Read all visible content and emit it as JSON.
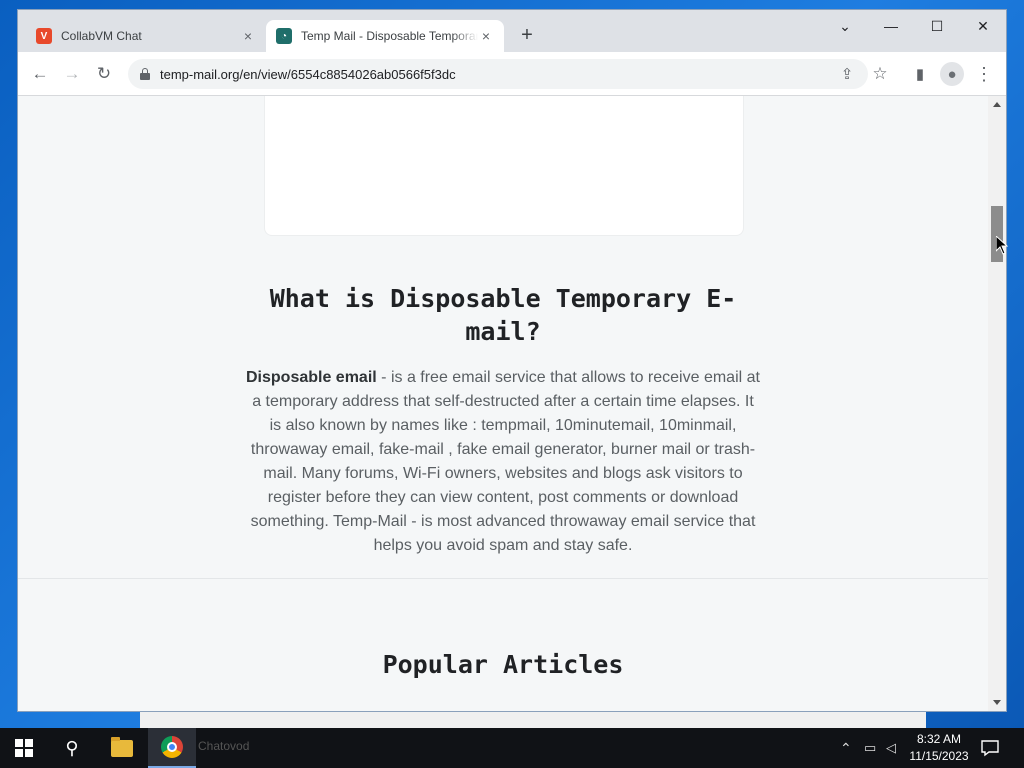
{
  "browser": {
    "tabs": [
      {
        "title": "CollabVM Chat",
        "active": false
      },
      {
        "title": "Temp Mail - Disposable Temporary E-mail",
        "active": true
      }
    ],
    "url": "temp-mail.org/en/view/6554c8854026ab0566f5f3dc"
  },
  "page": {
    "heading_what": "What is Disposable Temporary E-mail?",
    "desc_bold": "Disposable email",
    "desc_text": " - is a free email service that allows to receive email at a temporary address that self-destructed after a certain time elapses. It is also known by names like : tempmail, 10minutemail, 10minmail, throwaway email, fake-mail , fake email generator, burner mail or trash-mail. Many forums, Wi-Fi owners, websites and blogs ask visitors to register before they can view content, post comments or download something. Temp-Mail - is most advanced throwaway email service that helps you avoid spam and stay safe.",
    "heading_popular": "Popular Articles"
  },
  "taskbar": {
    "ghost_label": "Chatovod",
    "time": "8:32 AM",
    "date": "11/15/2023"
  },
  "icons": {
    "tab_close": "×",
    "new_tab": "+",
    "minimize": "—",
    "maximize": "☐",
    "close": "✕",
    "tab_search": "⌄",
    "back": "←",
    "forward": "→",
    "reload": "↻",
    "share": "⇪",
    "star": "☆",
    "sidepanel": "▮",
    "profile": "●",
    "menu": "⋮",
    "search": "⚲",
    "chat": "🗨"
  },
  "colors": {
    "tabstrip": "#dee1e6",
    "page_bg": "#f5f7f8",
    "taskbar": "#101216"
  }
}
